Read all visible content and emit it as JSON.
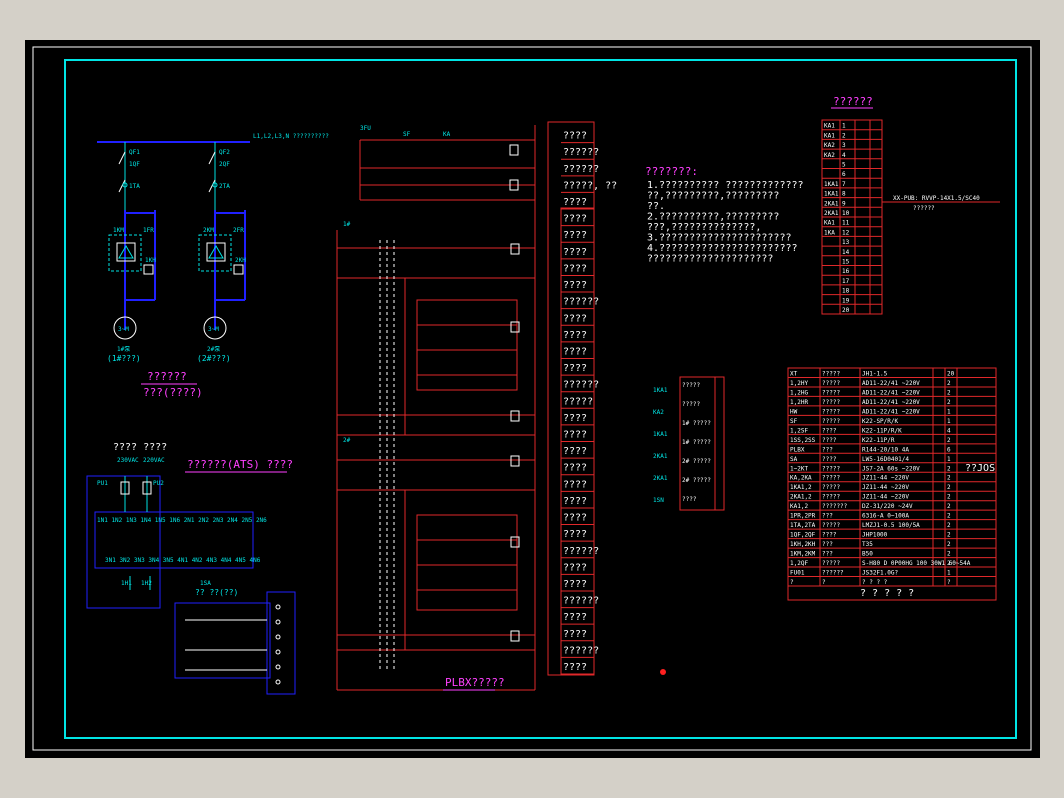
{
  "motor_section": {
    "bus_label": "L1,L2,L3,N ??????????",
    "branch1": [
      "QF1",
      "1QF",
      "1TA",
      "1KM",
      "1FR",
      "1KH"
    ],
    "branch2": [
      "QF2",
      "2QF",
      "2TA",
      "2KM",
      "2FR",
      "2KH"
    ],
    "motor1": "1#泵",
    "motor1_sub": "(1#???)",
    "motor2": "2#泵",
    "motor2_sub": "(2#???)",
    "title": "??????",
    "subtitle": "???(????)"
  },
  "ats_section": {
    "top_label": "???? ????",
    "title": "??????(ATS) ????",
    "volt1": "230VAC",
    "volt2": "220VAC",
    "sw_title": "?? ??(??)",
    "sw_label": "1SA",
    "sub_labels": [
      "1H1",
      "1H2"
    ]
  },
  "control_section": {
    "top_labels": [
      "3FU",
      "KA",
      "SF"
    ],
    "groups": [
      "1#",
      "2#"
    ],
    "footer": "PLBX?????",
    "right_labels": [
      "????",
      "??????",
      "??????",
      "?????, ??",
      "????",
      "????",
      "????",
      "????",
      "????",
      "????",
      "??????",
      "????",
      "????",
      "????",
      "????",
      "??????",
      "?????",
      "????",
      "????",
      "????",
      "????",
      "????",
      "????",
      "????",
      "????",
      "??????",
      "????",
      "????",
      "??????",
      "????",
      "????",
      "??????",
      "????"
    ]
  },
  "notes": {
    "title": "???????:",
    "lines": [
      "1.?????????? ?????????????",
      "  ??,?????????,?????????",
      "  ??.",
      "2.??????????,?????????",
      "  ???,??????????????,",
      "3.??????????????????????",
      "4.???????????????????????",
      "  ?????????????????????"
    ]
  },
  "terminal": {
    "title": "??????",
    "cable_label": "XX-PUB: RVVP-14X1.5/SC40",
    "cable_sub": "??????",
    "rows": [
      {
        "n": "1",
        "t": "KA1"
      },
      {
        "n": "2",
        "t": "KA1"
      },
      {
        "n": "3",
        "t": "KA2"
      },
      {
        "n": "4",
        "t": "KA2"
      },
      {
        "n": "5",
        "t": ""
      },
      {
        "n": "6",
        "t": ""
      },
      {
        "n": "7",
        "t": "1KA1"
      },
      {
        "n": "8",
        "t": "1KA1"
      },
      {
        "n": "9",
        "t": "2KA1"
      },
      {
        "n": "10",
        "t": "2KA1"
      },
      {
        "n": "11",
        "t": "KA1"
      },
      {
        "n": "12",
        "t": "1KA"
      },
      {
        "n": "13",
        "t": ""
      },
      {
        "n": "14",
        "t": ""
      },
      {
        "n": "15",
        "t": ""
      },
      {
        "n": "16",
        "t": ""
      },
      {
        "n": "17",
        "t": ""
      },
      {
        "n": "18",
        "t": ""
      },
      {
        "n": "19",
        "t": ""
      },
      {
        "n": "20",
        "t": ""
      }
    ]
  },
  "relay_legend": {
    "items": [
      "1KA1",
      "KA2",
      "1KA1",
      "2KA1",
      "2KA1",
      "1SN"
    ],
    "labels": [
      "?????",
      "?????",
      "1# ?????",
      "1# ?????",
      "2# ?????",
      "2# ?????",
      "????"
    ]
  },
  "bom": {
    "title": "? ? ? ? ?",
    "side_label": "??JOS",
    "rows": [
      {
        "code": "XT",
        "name": "?????",
        "model": "JH1-1.5",
        "qty": "20"
      },
      {
        "code": "1,2HY",
        "name": "?????",
        "model": "AD11-22/41 ~220V",
        "qty": "2"
      },
      {
        "code": "1,2HG",
        "name": "?????",
        "model": "AD11-22/41 ~220V",
        "qty": "2"
      },
      {
        "code": "1,2HR",
        "name": "?????",
        "model": "AD11-22/41 ~220V",
        "qty": "2"
      },
      {
        "code": "HW",
        "name": "?????",
        "model": "AD11-22/41 ~220V",
        "qty": "1"
      },
      {
        "code": "SF",
        "name": "?????",
        "model": "K22-SP/R/K",
        "qty": "1"
      },
      {
        "code": "1,2SF",
        "name": "????",
        "model": "K22-11P/R/K",
        "qty": "4"
      },
      {
        "code": "1SS,2SS",
        "name": "????",
        "model": "K22-11P/R",
        "qty": "2"
      },
      {
        "code": "PLBX",
        "name": "???",
        "model": "R144-20/10 4A",
        "qty": "6"
      },
      {
        "code": "SA",
        "name": "????",
        "model": "LW5-16D0401/4",
        "qty": "1"
      },
      {
        "code": "1~2KT",
        "name": "?????",
        "model": "JS7-2A 60s ~220V",
        "qty": "2"
      },
      {
        "code": "KA,2KA",
        "name": "?????",
        "model": "JZ11-44 ~220V",
        "qty": "2"
      },
      {
        "code": "1KA1,2",
        "name": "?????",
        "model": "JZ11-44 ~220V",
        "qty": "2"
      },
      {
        "code": "2KA1,2",
        "name": "?????",
        "model": "JZ11-44 ~220V",
        "qty": "2"
      },
      {
        "code": "KA1,2",
        "name": "???????",
        "model": "DZ-31/220 ~24V",
        "qty": "2"
      },
      {
        "code": "1PR,2PR",
        "name": "???",
        "model": "6316-A 0~100A",
        "qty": "2"
      },
      {
        "code": "1TA,2TA",
        "name": "?????",
        "model": "LMZJ1-0.5 100/5A",
        "qty": "2"
      },
      {
        "code": "1QF,2QF",
        "name": "????",
        "model": "JHP1000",
        "qty": "2"
      },
      {
        "code": "1KH,2KH",
        "name": "???",
        "model": "T35",
        "qty": "2"
      },
      {
        "code": "1KM,2KM",
        "name": "???",
        "model": "B50",
        "qty": "2"
      },
      {
        "code": "1,2QF",
        "name": "?????",
        "model": "S-H80 D 0P00HG 100 30W1 60~54A",
        "qty": "2"
      },
      {
        "code": "FU01",
        "name": "??????",
        "model": "JS32F1.0G?",
        "qty": "1"
      },
      {
        "code": "?",
        "name": "?",
        "model": "? ? ? ?",
        "qty": "?"
      }
    ]
  }
}
